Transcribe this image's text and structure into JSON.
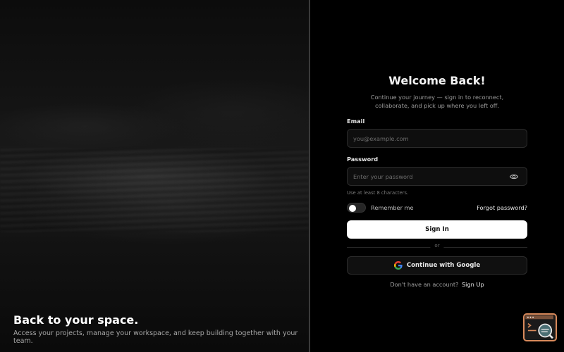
{
  "hero": {
    "title": "Back to your space.",
    "subtitle": "Access your projects, manage your workspace, and keep building together with your team."
  },
  "form": {
    "title": "Welcome Back!",
    "subtitle": "Continue your journey — sign in to reconnect, collaborate, and pick up where you left off.",
    "email_label": "Email",
    "email_placeholder": "you@example.com",
    "email_value": "",
    "password_label": "Password",
    "password_placeholder": "Enter your password",
    "password_value": "",
    "password_hint": "Use at least 8 characters.",
    "remember_label": "Remember me",
    "remember_checked": false,
    "forgot_label": "Forgot password?",
    "signin_label": "Sign In",
    "or_label": "or",
    "google_label": "Continue with Google",
    "signup_prompt": "Don't have an account?",
    "signup_label": "Sign Up"
  },
  "icons": {
    "password_toggle": "eye-icon",
    "google": "google-icon",
    "corner_badge": "terminal-search-icon"
  },
  "colors": {
    "background": "#000000",
    "primary_button": "#ffffff",
    "input_background": "#0e0e0e",
    "badge_accent": "#d98a5b",
    "google_blue": "#4285F4",
    "google_red": "#EA4335",
    "google_yellow": "#FBBC05",
    "google_green": "#34A853"
  }
}
